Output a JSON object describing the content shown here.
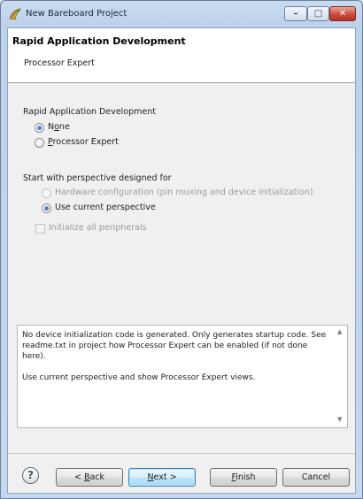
{
  "window": {
    "title": "New Bareboard Project"
  },
  "header": {
    "title": "Rapid Application Development",
    "subtitle": "Processor Expert"
  },
  "rad_group": {
    "label": "Rapid Application Development",
    "options": [
      {
        "pre": "N",
        "mnemonic": "o",
        "post": "ne",
        "checked": true,
        "enabled": true
      },
      {
        "pre": "",
        "mnemonic": "P",
        "post": "rocessor Expert",
        "checked": false,
        "enabled": true
      }
    ]
  },
  "perspective_group": {
    "label": "Start with perspective designed for",
    "options": [
      {
        "text": "Hardware configuration (pin muxing and device initialization)",
        "checked": false,
        "enabled": false
      },
      {
        "text": "Use current perspective",
        "checked": true,
        "enabled": true
      }
    ],
    "checkbox": {
      "text": "Initialize all peripherals",
      "checked": false,
      "enabled": false
    }
  },
  "info": {
    "paragraphs": [
      "No device initialization code is generated. Only generates startup code. See readme.txt in project how Processor Expert can be enabled (if not done here).",
      "Use current perspective and show Processor Expert views."
    ]
  },
  "buttons": {
    "back": {
      "pre": "< ",
      "mnemonic": "B",
      "post": "ack"
    },
    "next": {
      "pre": "",
      "mnemonic": "N",
      "post": "ext >"
    },
    "finish": {
      "pre": "",
      "mnemonic": "F",
      "post": "inish"
    },
    "cancel": {
      "label": "Cancel"
    },
    "help": "?"
  },
  "title_buttons": {
    "minimize": "–",
    "maximize": "□",
    "close": "✕"
  }
}
